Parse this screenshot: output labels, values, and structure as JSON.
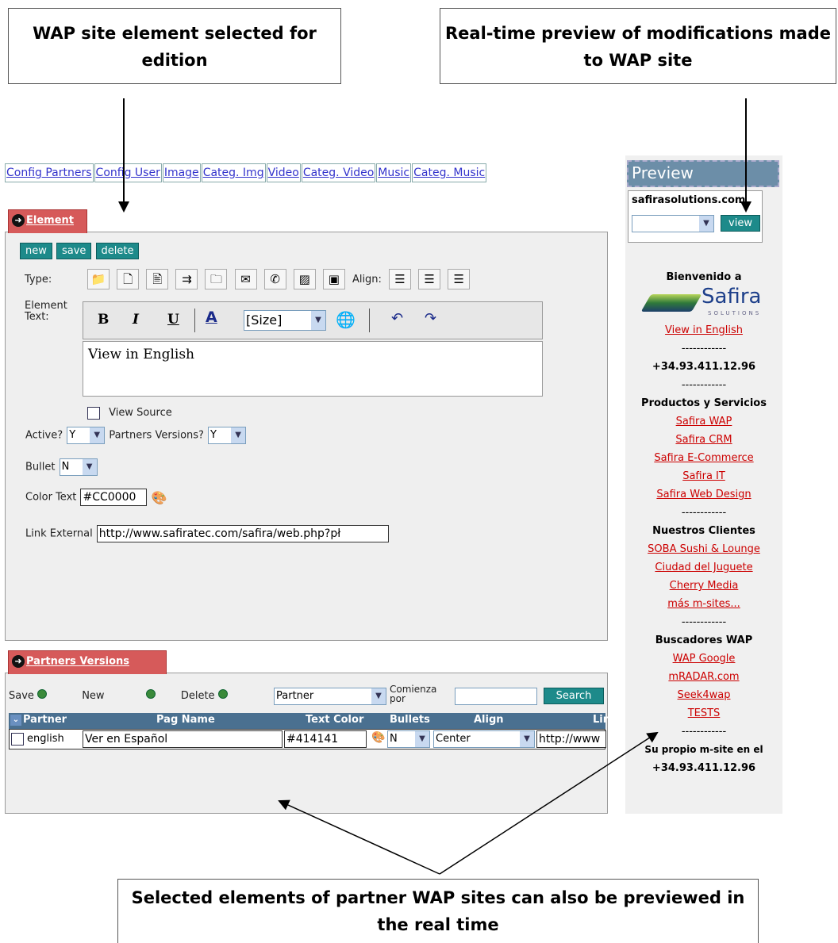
{
  "callouts": {
    "top_left": "WAP site element selected for edition",
    "top_right": "Real-time preview of modifications made to WAP site",
    "bottom": "Selected elements of partner WAP sites can also be previewed in the real time"
  },
  "tabs": [
    "Config Partners",
    "Config User",
    "Image",
    "Categ. Img",
    "Video",
    "Categ. Video",
    "Music",
    "Categ. Music"
  ],
  "element": {
    "section_tab": "Element",
    "buttons": {
      "new": "new",
      "save": "save",
      "delete": "delete"
    },
    "type_label": "Type:",
    "align_label": "Align:",
    "element_text_label_1": "Element",
    "element_text_label_2": "Text:",
    "toolbar": {
      "bold": "B",
      "italic": "I",
      "underline": "U",
      "size": "[Size]"
    },
    "editor_text": "View in English",
    "view_source": "View Source",
    "active_label": "Active?",
    "active_value": "Y",
    "partners_versions_label": "Partners Versions?",
    "partners_versions_value": "Y",
    "bullet_label": "Bullet",
    "bullet_value": "N",
    "color_text_label": "Color Text",
    "color_text_value": "#CC0000",
    "link_external_label": "Link External",
    "link_external_value": "http://www.safiratec.com/safira/web.php?pł"
  },
  "partners": {
    "section_tab": "Partners Versions",
    "save_label": "Save",
    "new_label": "New",
    "delete_label": "Delete",
    "partner_select": "Partner",
    "comienza_label_1": "Comienza",
    "comienza_label_2": "por",
    "search_button": "Search",
    "columns": [
      "Partner",
      "Pag Name",
      "Text Color",
      "Bullets",
      "Align",
      "Lir"
    ],
    "row": {
      "partner": "english",
      "pag_name": "Ver en Español",
      "text_color": "#414141",
      "bullets": "N",
      "align": "Center",
      "link": "http://www"
    }
  },
  "preview": {
    "header": "Preview",
    "domain": "safirasolutions.com",
    "view_button": "view",
    "welcome": "Bienvenido a",
    "logo_text": "Safira",
    "logo_sub": "SOLUTIONS",
    "link_english": "View in English",
    "divider": "------------",
    "phone": "+34.93.411.12.96",
    "products_title": "Productos y Servicios",
    "products": [
      "Safira WAP",
      "Safira CRM",
      "Safira E-Commerce",
      "Safira IT",
      "Safira Web Design"
    ],
    "clients_title": "Nuestros Clientes",
    "clients": [
      "SOBA Sushi & Lounge",
      "Ciudad del Juguete",
      "Cherry Media",
      "más m-sites..."
    ],
    "search_title": "Buscadores WAP",
    "search_engines": [
      "WAP Google",
      "mRADAR.com",
      "Seek4wap",
      "TESTS"
    ],
    "own_site": "Su propio m-site en el",
    "phone2": "+34.93.411.12.96"
  }
}
